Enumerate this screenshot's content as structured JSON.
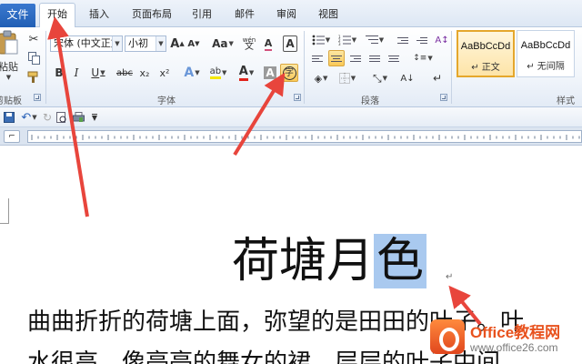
{
  "tabs": {
    "file": "文件",
    "items": [
      "开始",
      "插入",
      "页面布局",
      "引用",
      "邮件",
      "审阅",
      "视图"
    ]
  },
  "clipboard": {
    "paste_label": "粘贴",
    "group_label": "剪贴板"
  },
  "font_group": {
    "font_name": "宋体 (中文正文)",
    "font_size": "小初",
    "group_label": "字体",
    "grow_label": "A",
    "shrink_label": "A",
    "case_label": "Aa",
    "bold": "B",
    "italic": "I",
    "underline": "U",
    "strike": "abc",
    "subscript": "x₂",
    "superscript": "x²",
    "text_effect": "A",
    "highlight": "ab",
    "font_color": "A",
    "char_shading": "A",
    "enclose_char": "字",
    "phonetic_guide": "文",
    "phonetic_top": "wén",
    "clear_format": "A"
  },
  "paragraph_group": {
    "group_label": "段落"
  },
  "styles": {
    "group_label": "样式",
    "items": [
      {
        "sample": "AaBbCcDd",
        "name": "↵ 正文"
      },
      {
        "sample": "AaBbCcDd",
        "name": "↵ 无间隔"
      }
    ]
  },
  "document": {
    "title_start": "荷塘月",
    "title_selected": "色",
    "paragraph_mark": "↵",
    "line1": "曲曲折折的荷塘上面，弥望的是田田的叶子。叶",
    "line2": "水很高，像亭亭的舞女的裙。层层的叶子中间，"
  },
  "watermark": {
    "title": "Office教程网",
    "url": "www.office26.com"
  },
  "colors": {
    "accent": "#2b63b8",
    "arrow": "#e8453c",
    "selection": "#a9c9ef",
    "active_button": "#fac957"
  }
}
